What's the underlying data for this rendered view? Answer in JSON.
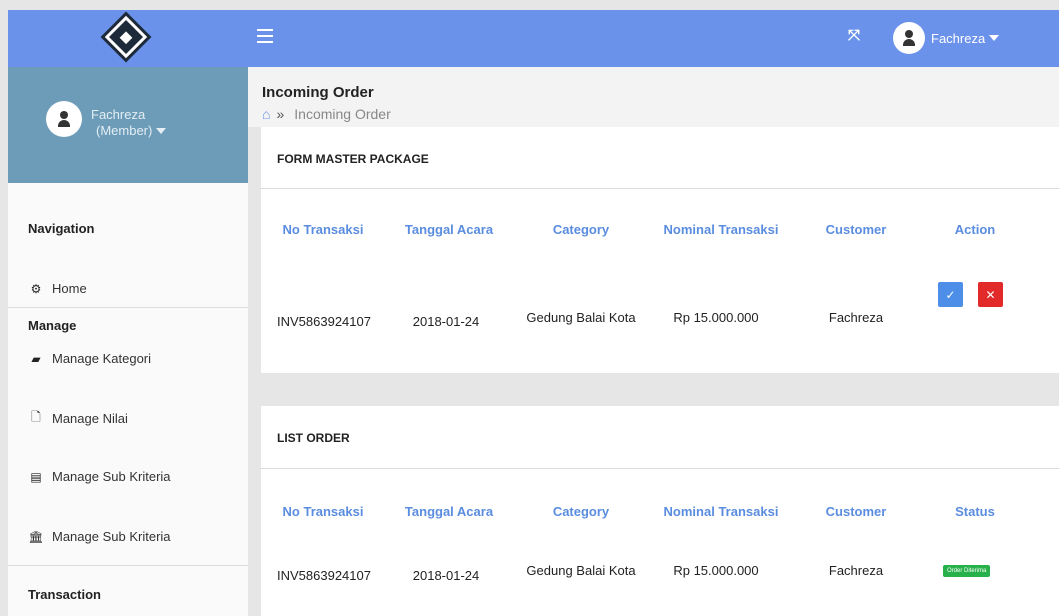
{
  "topbar": {
    "user_name": "Fachreza"
  },
  "sidebar": {
    "profile_name": "Fachreza",
    "profile_role": "(Member)",
    "navigation_heading": "Navigation",
    "home_label": "Home",
    "manage_heading": "Manage",
    "items": [
      {
        "label": "Manage Kategori",
        "icon": "book-icon"
      },
      {
        "label": "Manage Nilai",
        "icon": "file-icon"
      },
      {
        "label": "Manage Sub Kriteria",
        "icon": "list-icon"
      },
      {
        "label": "Manage Sub Kriteria",
        "icon": "bank-icon"
      }
    ],
    "transaction_heading": "Transaction"
  },
  "header": {
    "title": "Incoming Order",
    "breadcrumb_sep": "»",
    "breadcrumb_current": "Incoming Order"
  },
  "form_panel": {
    "title": "FORM MASTER PACKAGE",
    "columns": [
      "No Transaksi",
      "Tanggal Acara",
      "Category",
      "Nominal Transaksi",
      "Customer",
      "Action"
    ],
    "row": {
      "no_transaksi": "INV5863924107",
      "tanggal_acara": "2018-01-24",
      "category": "Gedung Balai Kota",
      "nominal": "Rp 15.000.000",
      "customer": "Fachreza",
      "accept_symbol": "✓",
      "reject_symbol": "✕"
    }
  },
  "list_panel": {
    "title": "LIST ORDER",
    "columns": [
      "No Transaksi",
      "Tanggal Acara",
      "Category",
      "Nominal Transaksi",
      "Customer",
      "Status"
    ],
    "row": {
      "no_transaksi": "INV5863924107",
      "tanggal_acara": "2018-01-24",
      "category": "Gedung Balai Kota",
      "nominal": "Rp 15.000.000",
      "customer": "Fachreza",
      "status": "Order Diterima"
    }
  },
  "colors": {
    "topbar": "#6b92ea",
    "profile_bg": "#6c9cb8",
    "header_text": "#5a8de0",
    "accept": "#4d8ee8",
    "reject": "#e32a2a",
    "status": "#28b04a"
  }
}
